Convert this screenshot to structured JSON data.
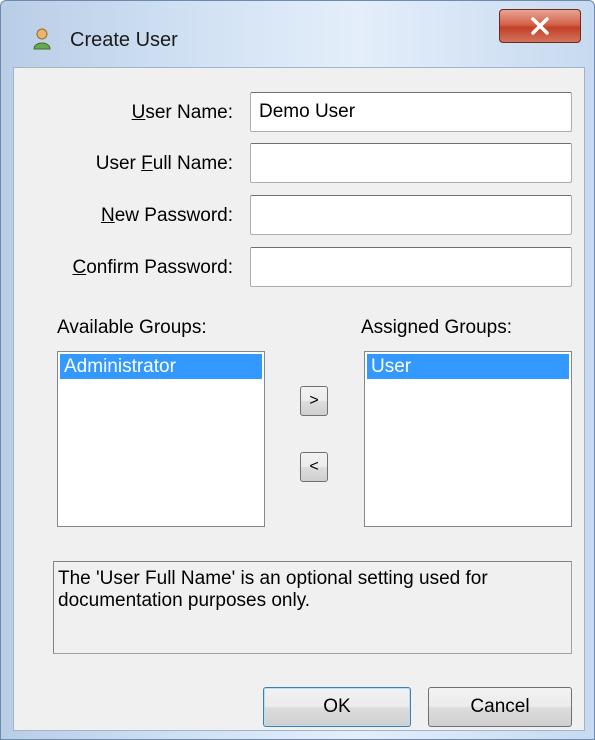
{
  "window": {
    "title": "Create User",
    "close_glyph": "X"
  },
  "form": {
    "user_name_label_mnemonic": "U",
    "user_name_label_rest": "ser Name:",
    "user_name_value": "Demo User",
    "full_name_label_pre": "User ",
    "full_name_label_mnemonic": "F",
    "full_name_label_rest": "ull Name:",
    "full_name_value": "",
    "new_password_label_mnemonic": "N",
    "new_password_label_rest": "ew Password:",
    "new_password_value": "",
    "confirm_password_label_mnemonic": "C",
    "confirm_password_label_rest": "onfirm Password:",
    "confirm_password_value": ""
  },
  "groups": {
    "available_label": "Available Groups:",
    "assigned_label": "Assigned Groups:",
    "available": [
      "Administrator"
    ],
    "assigned": [
      "User"
    ],
    "add_button": ">",
    "remove_button": "<"
  },
  "info": {
    "text": "The 'User Full Name' is an optional setting used for documentation purposes only."
  },
  "buttons": {
    "ok": "OK",
    "cancel": "Cancel"
  },
  "icons": {
    "app": "user-icon",
    "close": "close-icon"
  },
  "colors": {
    "selection": "#3399ff",
    "close_button": "#c24128"
  }
}
